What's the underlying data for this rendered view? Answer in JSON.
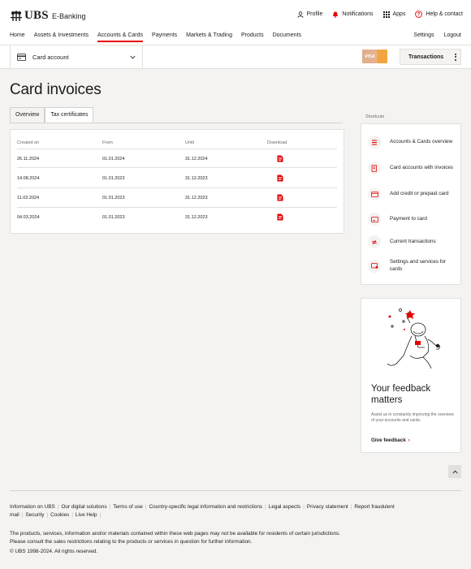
{
  "brand": {
    "logo_text": "UBS",
    "app_name": "E-Banking",
    "accent": "#e60000"
  },
  "top_actions": [
    {
      "label": "Profile",
      "icon": "user-icon"
    },
    {
      "label": "Notifications",
      "icon": "bell-icon"
    },
    {
      "label": "Apps",
      "icon": "grid-icon"
    },
    {
      "label": "Help & contact",
      "icon": "help-icon"
    }
  ],
  "main_nav": [
    {
      "label": "Home"
    },
    {
      "label": "Assets & Investments"
    },
    {
      "label": "Accounts & Cards",
      "active": true
    },
    {
      "label": "Payments"
    },
    {
      "label": "Markets & Trading"
    },
    {
      "label": "Products"
    },
    {
      "label": "Documents"
    }
  ],
  "right_nav": {
    "settings": "Settings",
    "logout": "Logout"
  },
  "subbar": {
    "account_label": "Card account",
    "card_brand": "VISA",
    "transactions_label": "Transactions"
  },
  "page": {
    "title": "Card invoices"
  },
  "tabs": [
    {
      "label": "Overview"
    },
    {
      "label": "Tax certificates",
      "active": true
    }
  ],
  "table": {
    "headers": {
      "created_on": "Created on",
      "from": "From",
      "until": "Until",
      "download": "Download"
    },
    "rows": [
      {
        "created_on": "26.11.2024",
        "from": "01.01.2024",
        "until": "31.12.2024"
      },
      {
        "created_on": "14.08.2024",
        "from": "01.01.2023",
        "until": "31.12.2023"
      },
      {
        "created_on": "11.03.2024",
        "from": "01.01.2023",
        "until": "31.12.2023"
      },
      {
        "created_on": "04.03.2024",
        "from": "01.01.2023",
        "until": "31.12.2023"
      }
    ]
  },
  "shortcuts": {
    "title": "Shortcuts",
    "items": [
      {
        "label": "Accounts & Cards overview",
        "icon": "list-icon"
      },
      {
        "label": "Card accounts with invoices",
        "icon": "invoice-icon"
      },
      {
        "label": "Add credit or prepaid card",
        "icon": "add-card-icon"
      },
      {
        "label": "Payment to card",
        "icon": "card-payment-icon"
      },
      {
        "label": "Current transactions",
        "icon": "transfer-icon"
      },
      {
        "label": "Settings and services for cards",
        "icon": "card-settings-icon"
      }
    ]
  },
  "feedback": {
    "title": "Your feedback matters",
    "text": "Assist us in constantly improving the overview of your accounts and cards.",
    "link": "Give feedback"
  },
  "footer": {
    "links": [
      "Information on UBS",
      "Our digital solutions",
      "Terms of use",
      "Country-specific legal information and restrictions",
      "Legal aspects",
      "Privacy statement",
      "Report fraudulent mail",
      "Security",
      "Cookies",
      "Live Help"
    ],
    "note_1": "The products, services, information and/or materials contained within these web pages may not be available for residents of certain jurisdictions.",
    "note_2": "Please consult the sales restrictions relating to the products or services in question for further information.",
    "copyright": "© UBS 1998-2024. All rights reserved."
  }
}
